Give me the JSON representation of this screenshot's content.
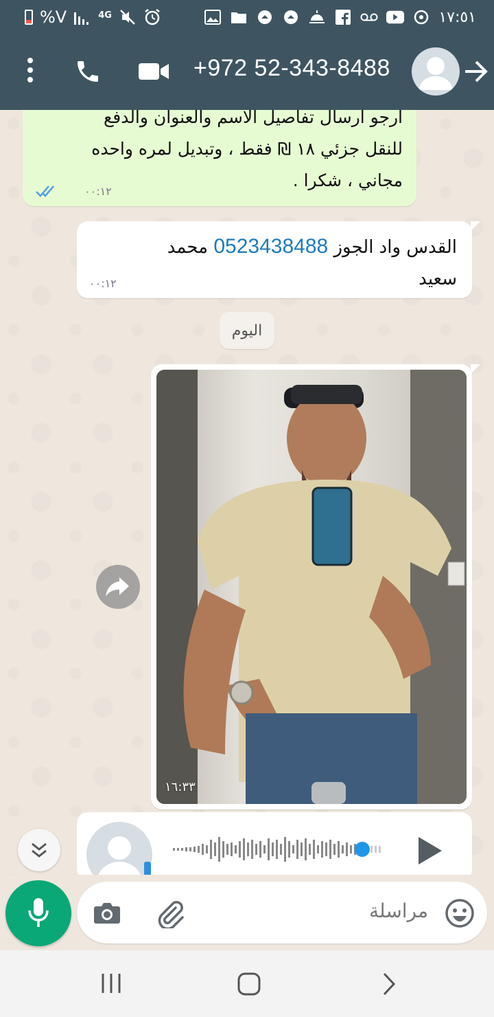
{
  "status_bar": {
    "battery": "%V",
    "network": "4G",
    "time": "١٧:٥١"
  },
  "header": {
    "contact": "+972 52-343-8488",
    "icons": [
      "more-vert-icon",
      "phone-icon",
      "video-call-icon",
      "avatar",
      "back-arrow-icon"
    ]
  },
  "messages": [
    {
      "type": "outgoing",
      "text_line1": "ارجو ارسال تفاصيل الاسم والعنوان والدفع",
      "text_line2": "للنقل جزئي ١٨ ₪ فقط ، وتبديل لمره واحده",
      "text_line3": "مجاني ، شكرا .",
      "time": "٠٠:١٢",
      "status": "read"
    },
    {
      "type": "incoming",
      "text_before": "القدس واد الجوز ",
      "phone": "0523438488",
      "text_after": " محمد",
      "text_line2": "سعيد",
      "time": "٠٠:١٢"
    },
    {
      "type": "incoming-photo",
      "time": "١٦:٣٣"
    },
    {
      "type": "incoming-voice"
    }
  ],
  "date_separator": "اليوم",
  "input": {
    "placeholder": "مراسلة"
  },
  "colors": {
    "header": "#3e5561",
    "outgoing_bubble": "#e7fbd3",
    "incoming_bubble": "#ffffff",
    "accent": "#0aa876",
    "link": "#1e7bbd",
    "read_ticks": "#4fa3e0"
  }
}
